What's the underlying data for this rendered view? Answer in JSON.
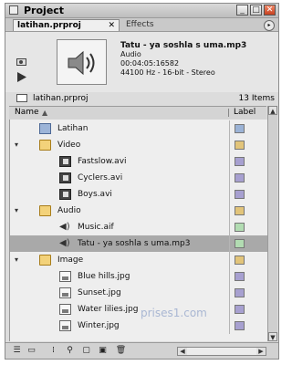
{
  "window": {
    "title": "Project",
    "controls": [
      "minimize-icon",
      "maximize-icon",
      "close-icon"
    ]
  },
  "tabs": [
    {
      "label": "latihan.prproj",
      "active": true
    },
    {
      "label": "Effects",
      "active": false
    }
  ],
  "preview": {
    "file_name": "Tatu - ya soshla s uma.mp3",
    "type": "Audio",
    "duration": "00:04:05:16582",
    "format": "44100 Hz - 16-bit - Stereo"
  },
  "project_bar": {
    "name": "latihan.prproj",
    "item_count": "13 Items"
  },
  "list_header": {
    "name": "Name",
    "label": "Label"
  },
  "rows": [
    {
      "text": "Latihan",
      "icon": "sequence-icon",
      "expand": "",
      "label_color": "#9bb3d6",
      "selected": false
    },
    {
      "text": "Video",
      "icon": "folder-icon",
      "expand": "▾",
      "label_color": "#e2c47a",
      "selected": false
    },
    {
      "text": "Fastslow.avi",
      "icon": "film-icon",
      "expand": "",
      "label_color": "#a7a0d0",
      "selected": false
    },
    {
      "text": "Cyclers.avi",
      "icon": "film-icon",
      "expand": "",
      "label_color": "#a7a0d0",
      "selected": false
    },
    {
      "text": "Boys.avi",
      "icon": "film-icon",
      "expand": "",
      "label_color": "#a7a0d0",
      "selected": false
    },
    {
      "text": "Audio",
      "icon": "folder-icon",
      "expand": "▾",
      "label_color": "#e2c47a",
      "selected": false
    },
    {
      "text": "Music.aif",
      "icon": "audio-icon",
      "expand": "",
      "label_color": "#b2dcb2",
      "selected": false
    },
    {
      "text": "Tatu - ya soshla s uma.mp3",
      "icon": "audio-icon",
      "expand": "",
      "label_color": "#b2dcb2",
      "selected": true
    },
    {
      "text": "Image",
      "icon": "folder-icon",
      "expand": "▾",
      "label_color": "#e2c47a",
      "selected": false
    },
    {
      "text": "Blue hills.jpg",
      "icon": "image-icon",
      "expand": "",
      "label_color": "#a7a0d0",
      "selected": false
    },
    {
      "text": "Sunset.jpg",
      "icon": "image-icon",
      "expand": "",
      "label_color": "#a7a0d0",
      "selected": false
    },
    {
      "text": "Water lilies.jpg",
      "icon": "image-icon",
      "expand": "",
      "label_color": "#a7a0d0",
      "selected": false
    },
    {
      "text": "Winter.jpg",
      "icon": "image-icon",
      "expand": "",
      "label_color": "#a7a0d0",
      "selected": false
    }
  ],
  "footer_buttons": [
    "list-view-icon",
    "icon-view-icon",
    "automate-to-sequence-icon",
    "find-icon",
    "new-bin-icon",
    "new-item-icon",
    "delete-icon"
  ],
  "watermark": "prises1.com"
}
